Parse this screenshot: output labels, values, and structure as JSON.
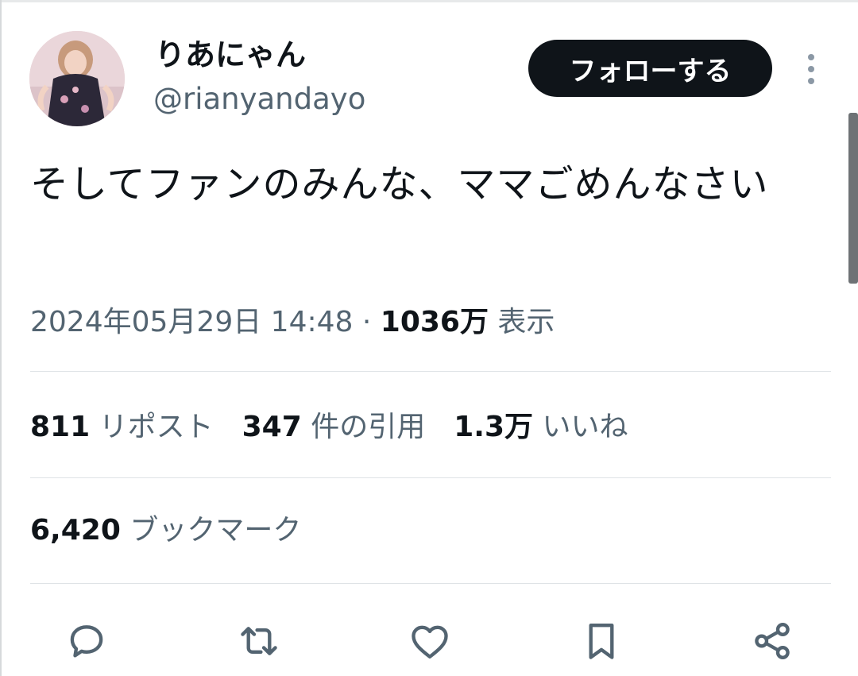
{
  "tweet": {
    "display_name": "りあにゃん",
    "handle": "@rianyandayo",
    "follow_label": "フォローする",
    "text": "そしてファンのみんな、ママごめんなさい",
    "timestamp": "2024年05月29日 14:48",
    "separator": " · ",
    "views_count": "1036万",
    "views_label": " 表示"
  },
  "stats": {
    "reposts": {
      "value": "811",
      "label": "リポスト"
    },
    "quotes": {
      "value": "347",
      "label": "件の引用"
    },
    "likes": {
      "value": "1.3万",
      "label": "いいね"
    },
    "bookmarks": {
      "value": "6,420",
      "label": "ブックマーク"
    }
  },
  "actions": [
    "reply-icon",
    "repost-icon",
    "like-icon",
    "bookmark-icon",
    "share-icon"
  ],
  "colors": {
    "text_primary": "#0f1419",
    "text_secondary": "#536471",
    "button_bg": "#0f1419",
    "divider": "#dfe3e6"
  }
}
